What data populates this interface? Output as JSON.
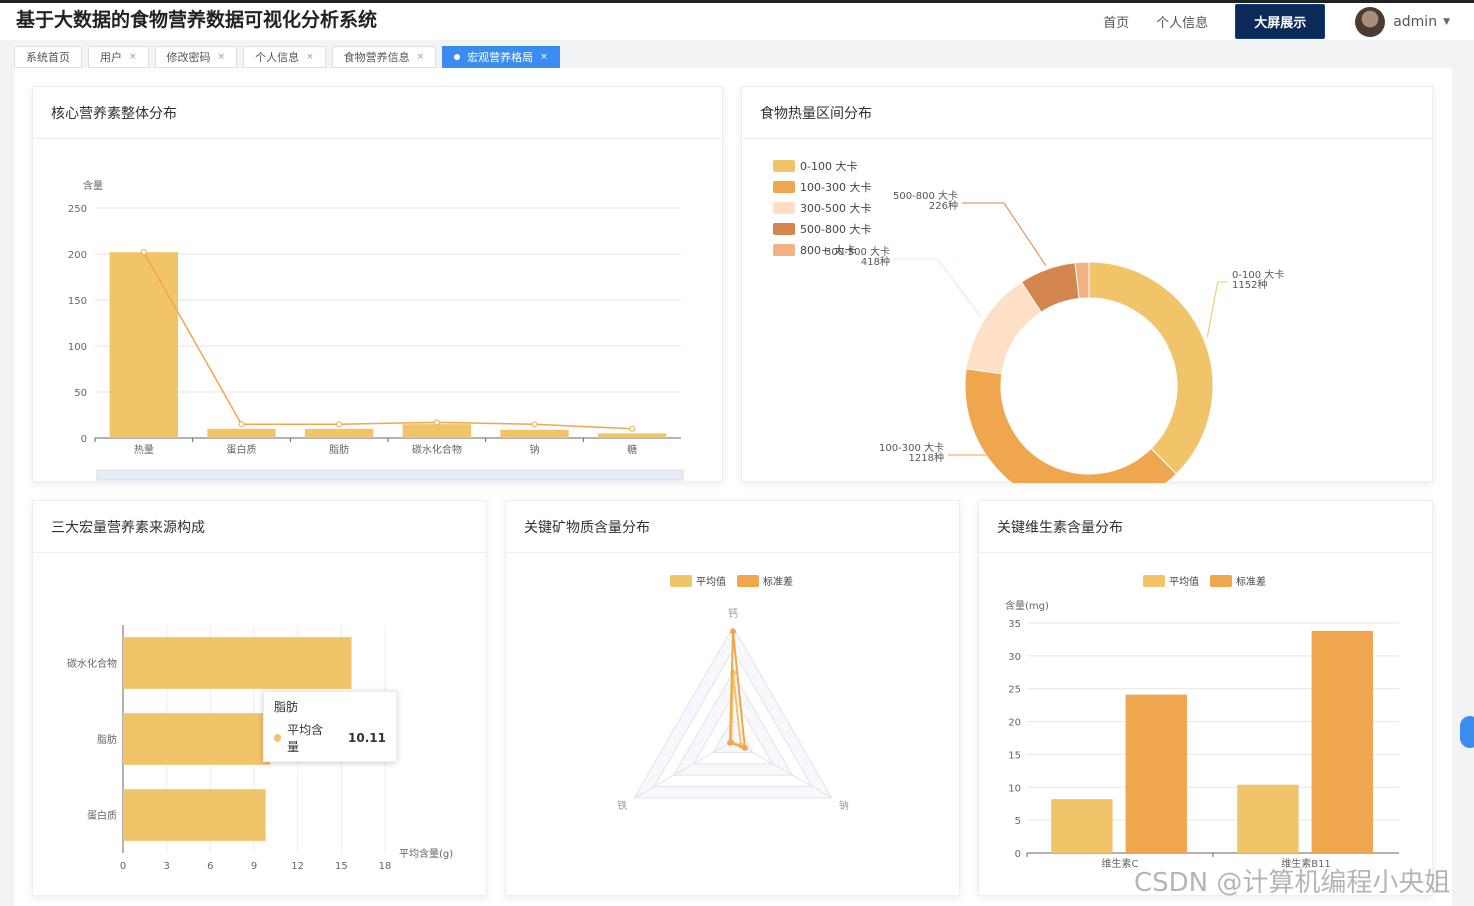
{
  "header": {
    "title": "基于大数据的食物营养数据可视化分析系统",
    "nav_home": "首页",
    "nav_profile": "个人信息",
    "big_screen": "大屏展示",
    "user": "admin"
  },
  "tabs": [
    {
      "label": "系统首页",
      "closable": false,
      "active": false
    },
    {
      "label": "用户",
      "closable": true,
      "active": false
    },
    {
      "label": "修改密码",
      "closable": true,
      "active": false
    },
    {
      "label": "个人信息",
      "closable": true,
      "active": false
    },
    {
      "label": "食物营养信息",
      "closable": true,
      "active": false
    },
    {
      "label": "宏观营养格局",
      "closable": true,
      "active": true
    }
  ],
  "close_glyph": "×",
  "cards": {
    "nutrient": "核心营养素整体分布",
    "calorie": "食物热量区间分布",
    "macro": "三大宏量营养素来源构成",
    "mineral": "关键矿物质含量分布",
    "vitamin": "关键维生素含量分布"
  },
  "tooltip": {
    "title": "脂肪",
    "label": "平均含量",
    "value": "10.11"
  },
  "watermark": "CSDN @计算机编程小央姐",
  "colors": {
    "yellow": "#f2c46a",
    "orange": "#efa64e",
    "peach": "#fde0c6",
    "brown": "#d4864e",
    "salmon": "#f1b283"
  },
  "chart_data": [
    {
      "type": "bar",
      "ylabel": "含量",
      "categories": [
        "热量",
        "蛋白质",
        "脂肪",
        "碳水化合物",
        "钠",
        "糖"
      ],
      "values": [
        202,
        10,
        10,
        15,
        9,
        5
      ],
      "line_values": [
        202,
        15,
        15,
        17,
        15,
        10
      ],
      "ylim": [
        0,
        250
      ],
      "yticks": [
        0,
        50,
        100,
        150,
        200,
        250
      ]
    },
    {
      "type": "pie",
      "donut": true,
      "legend": [
        "0-100 大卡",
        "100-300 大卡",
        "300-500 大卡",
        "500-800 大卡",
        "800+ 大卡"
      ],
      "labels": [
        [
          "0-100 大卡",
          "1152种"
        ],
        [
          "100-300 大卡",
          "1218种"
        ],
        [
          "300-500 大卡",
          "418种"
        ],
        [
          "500-800 大卡",
          "226种"
        ],
        [
          "800+ 大卡",
          ""
        ]
      ],
      "values": [
        1152,
        1218,
        418,
        226,
        55
      ]
    },
    {
      "type": "bar",
      "orientation": "horizontal",
      "categories": [
        "蛋白质",
        "脂肪",
        "碳水化合物"
      ],
      "values": [
        9.8,
        10.11,
        15.7
      ],
      "xlabel": "平均含量(g)",
      "xticks": [
        0,
        3,
        6,
        9,
        12,
        15,
        18
      ],
      "xlim": [
        0,
        18
      ]
    },
    {
      "type": "radar",
      "indicators": [
        "钙",
        "钠",
        "铁"
      ],
      "legend": [
        "平均值",
        "标准差"
      ],
      "series": [
        {
          "name": "平均值",
          "values": [
            0.6,
            0.08,
            0.02
          ]
        },
        {
          "name": "标准差",
          "values": [
            0.96,
            0.12,
            0.03
          ]
        }
      ]
    },
    {
      "type": "bar",
      "ylabel": "含量(mg)",
      "categories": [
        "维生素C",
        "维生素B11"
      ],
      "legend": [
        "平均值",
        "标准差"
      ],
      "series": [
        {
          "name": "平均值",
          "values": [
            8.2,
            10.4
          ]
        },
        {
          "name": "标准差",
          "values": [
            24.1,
            33.8
          ]
        }
      ],
      "ylim": [
        0,
        35
      ],
      "yticks": [
        0,
        5,
        10,
        15,
        20,
        25,
        30,
        35
      ]
    }
  ]
}
